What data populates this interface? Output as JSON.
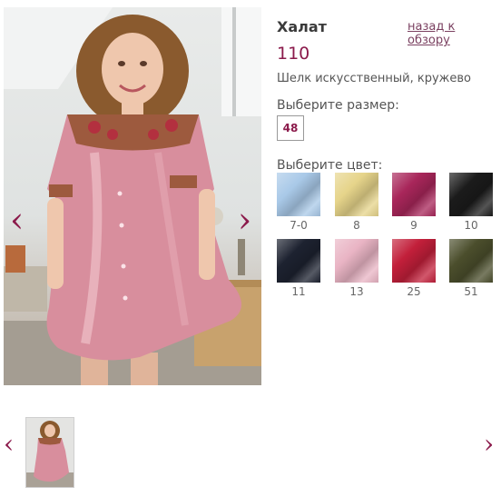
{
  "product": {
    "title": "Халат",
    "back_link": "назад к обзору",
    "price": "110",
    "material": "Шелк искусственный, кружево"
  },
  "size": {
    "label": "Выберите размер:",
    "options": [
      "48"
    ]
  },
  "color": {
    "label": "Выберите цвет:",
    "swatches": [
      {
        "code": "7-0",
        "hex": "#a9c9e8"
      },
      {
        "code": "8",
        "hex": "#e6d48a"
      },
      {
        "code": "9",
        "hex": "#a8265a"
      },
      {
        "code": "10",
        "hex": "#1b1b1b"
      },
      {
        "code": "11",
        "hex": "#1d2230"
      },
      {
        "code": "13",
        "hex": "#e9b4c4"
      },
      {
        "code": "25",
        "hex": "#c21f3a"
      },
      {
        "code": "51",
        "hex": "#4b4e2c"
      }
    ]
  },
  "gallery": {
    "prev_arrow": "‹",
    "next_arrow": "›",
    "thumb_prev_arrow": "‹",
    "thumb_next_arrow": "›"
  },
  "colors": {
    "accent": "#8b1a4b",
    "gown": "#d88e9d"
  }
}
